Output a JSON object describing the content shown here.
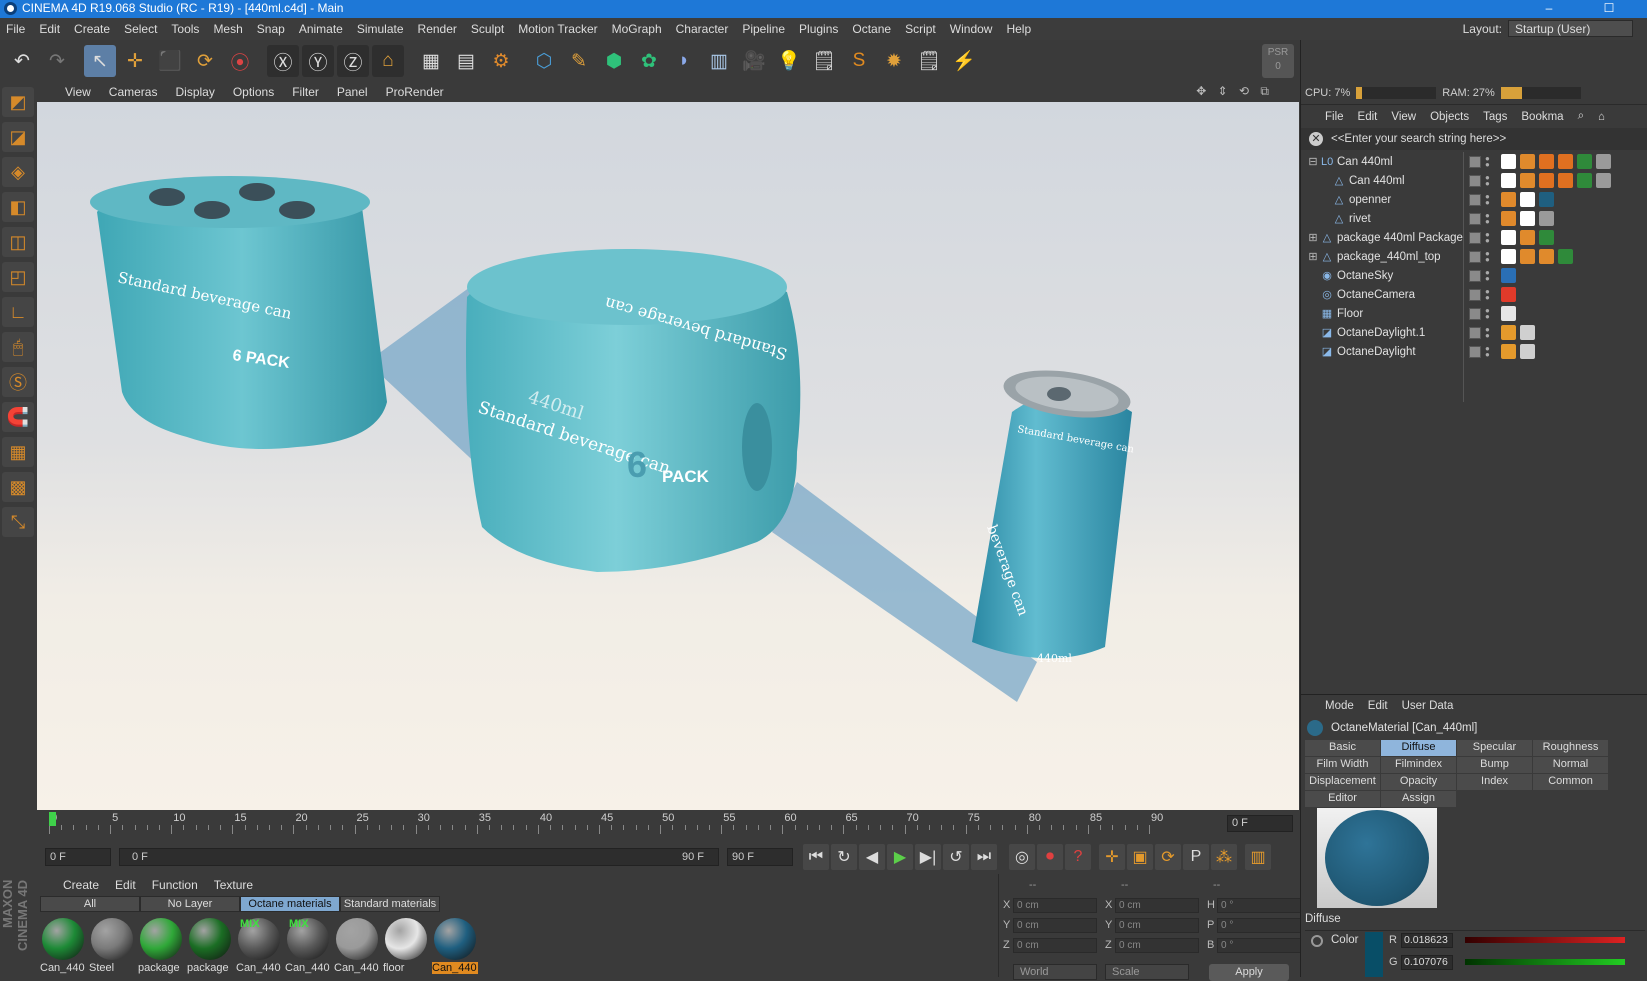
{
  "window": {
    "title": "CINEMA 4D R19.068 Studio (RC - R19) - [440ml.c4d] - Main",
    "min": "–",
    "max": "☐"
  },
  "menubar": [
    "File",
    "Edit",
    "Create",
    "Select",
    "Tools",
    "Mesh",
    "Snap",
    "Animate",
    "Simulate",
    "Render",
    "Sculpt",
    "Motion Tracker",
    "MoGraph",
    "Character",
    "Pipeline",
    "Plugins",
    "Octane",
    "Script",
    "Window",
    "Help"
  ],
  "layout": {
    "label": "Layout:",
    "value": "Startup (User)"
  },
  "toolbar_icons": [
    "undo-icon",
    "redo-icon",
    "live-select-icon",
    "move-icon",
    "scale-icon",
    "rotate-icon",
    "recent-tool-icon",
    "x-axis-icon",
    "y-axis-icon",
    "z-axis-icon",
    "coordinate-system-icon",
    "render-view-icon",
    "render-picture-viewer-icon",
    "render-settings-icon",
    "cube-icon",
    "pen-icon",
    "subdivision-icon",
    "cloner-icon",
    "deformer-icon",
    "floor-icon",
    "camera-icon",
    "light-icon",
    "octane-icon",
    "script-icon",
    "settings-icon",
    "live-viewer-icon",
    "paint-icon"
  ],
  "toolbar_glyphs": [
    "↶",
    "↷",
    "↖",
    "✛",
    "⬛",
    "⟳",
    "⦿",
    "Ⓧ",
    "Ⓨ",
    "Ⓩ",
    "⌂",
    "▦",
    "▤",
    "⚙",
    "⬡",
    "✎",
    "⬢",
    "✿",
    "◗",
    "▥",
    "🎥",
    "💡",
    "🗒",
    "S",
    "✹",
    "🗒",
    "⚡"
  ],
  "psr": {
    "label": "PSR",
    "value": "0"
  },
  "left_tools": [
    "◩",
    "◪",
    "◈",
    "◧",
    "◫",
    "◰",
    "∟",
    "🖱",
    "Ⓢ",
    "🧲",
    "▦",
    "▩",
    "⤡"
  ],
  "brand_vertical": "MAXON CINEMA 4D",
  "viewport_menu": [
    "View",
    "Cameras",
    "Display",
    "Options",
    "Filter",
    "Panel",
    "ProRender"
  ],
  "viewport_nav": "✥ ⇕ ⟲ ⧉",
  "scene_text": {
    "pack1_brand": "Standard beverage can",
    "pack1_pack": "6 PACK",
    "pack2_top": "Standard beverage can",
    "pack2_side": "Standard beverage can",
    "pack2_pack": "PACK",
    "pack2_six": "6",
    "pack2_ml": "440ml",
    "can_brand": "Standard beverage can",
    "can_ml": "440ml",
    "can_side": "beverage can"
  },
  "timeline": {
    "labels": [
      "0",
      "5",
      "10",
      "15",
      "20",
      "25",
      "30",
      "35",
      "40",
      "45",
      "50",
      "55",
      "60",
      "65",
      "70",
      "75",
      "80",
      "85",
      "90"
    ],
    "max": 90,
    "current_frame": "0 F"
  },
  "playback": {
    "start": "0 F",
    "range_start": "0 F",
    "range_end": "90 F",
    "end": "90 F",
    "buttons": [
      "⏮",
      "↻",
      "◀",
      "▶",
      "▶|",
      "↺",
      "⏭"
    ],
    "right_buttons": [
      "◎",
      "⏺",
      "?",
      "✛",
      "▣",
      "⟳",
      "P",
      "⁂",
      "▥"
    ]
  },
  "material_manager": {
    "menu": [
      "Create",
      "Edit",
      "Function",
      "Texture"
    ],
    "tabs": [
      "All",
      "No Layer",
      "Octane materials",
      "Standard materials"
    ],
    "active_tab": 2,
    "materials": [
      {
        "name": "Can_440",
        "color": "#1d8a36",
        "mix": ""
      },
      {
        "name": "Steel",
        "color": "#7a7a7a",
        "mix": ""
      },
      {
        "name": "package",
        "color": "#2fa838",
        "mix": ""
      },
      {
        "name": "package",
        "color": "#1b6e24",
        "mix": ""
      },
      {
        "name": "Can_440",
        "color": "#5a5a5a",
        "mix": "MIX"
      },
      {
        "name": "Can_440",
        "color": "#5a5a5a",
        "mix": "MIX"
      },
      {
        "name": "Can_440",
        "color": "#9a9a9a",
        "mix": ""
      },
      {
        "name": "floor",
        "color": "#e6e6e6",
        "mix": ""
      },
      {
        "name": "Can_440",
        "color": "#1f5f80",
        "mix": ""
      }
    ],
    "active_material": 8
  },
  "coordinates": {
    "header": [
      "--",
      "--",
      "--"
    ],
    "rows": [
      {
        "a": "X",
        "av": "0 cm",
        "b": "X",
        "bv": "0 cm",
        "c": "H",
        "cv": "0 °"
      },
      {
        "a": "Y",
        "av": "0 cm",
        "b": "Y",
        "bv": "0 cm",
        "c": "P",
        "cv": "0 °"
      },
      {
        "a": "Z",
        "av": "0 cm",
        "b": "Z",
        "bv": "0 cm",
        "c": "B",
        "cv": "0 °"
      }
    ],
    "space": "World",
    "mode": "Scale",
    "apply": "Apply"
  },
  "stats": {
    "cpu_label": "CPU: 7%",
    "cpu": 0.07,
    "ram_label": "RAM: 27%",
    "ram": 0.27
  },
  "object_manager": {
    "menu": [
      "File",
      "Edit",
      "View",
      "Objects",
      "Tags",
      "Bookma"
    ],
    "search_placeholder": "<<Enter your search string here>>",
    "objects": [
      {
        "name": "Can 440ml",
        "depth": 0,
        "expander": "⊟",
        "icon": "L0",
        "tags": [
          "#ffffff",
          "#e08a2c",
          "#e07020",
          "#e07020",
          "#2f8a3a",
          "#9a9a9a"
        ]
      },
      {
        "name": "Can 440ml",
        "depth": 1,
        "expander": "",
        "icon": "△",
        "tags": [
          "#ffffff",
          "#e08a2c",
          "#e07020",
          "#e07020",
          "#2f8a3a",
          "#9a9a9a"
        ]
      },
      {
        "name": "openner",
        "depth": 1,
        "expander": "",
        "icon": "△",
        "tags": [
          "#e08a2c",
          "#ffffff",
          "#1f5f80"
        ]
      },
      {
        "name": "rivet",
        "depth": 1,
        "expander": "",
        "icon": "△",
        "tags": [
          "#e08a2c",
          "#ffffff",
          "#9a9a9a"
        ]
      },
      {
        "name": "package 440ml Package",
        "depth": 0,
        "expander": "⊞",
        "icon": "△",
        "tags": [
          "#ffffff",
          "#e08a2c",
          "#2f8a3a"
        ]
      },
      {
        "name": "package_440ml_top",
        "depth": 0,
        "expander": "⊞",
        "icon": "△",
        "tags": [
          "#ffffff",
          "#e08a2c",
          "#e08a2c",
          "#2f8a3a"
        ]
      },
      {
        "name": "OctaneSky",
        "depth": 0,
        "expander": "",
        "icon": "◉",
        "tags": [
          "#2a6fb5"
        ]
      },
      {
        "name": "OctaneCamera",
        "depth": 0,
        "expander": "",
        "icon": "◎",
        "tags": [
          "#e03a2a"
        ]
      },
      {
        "name": "Floor",
        "depth": 0,
        "expander": "",
        "icon": "▦",
        "tags": [
          "#e6e6e6"
        ]
      },
      {
        "name": "OctaneDaylight.1",
        "depth": 0,
        "expander": "",
        "icon": "◪",
        "tags": [
          "#e49a2c",
          "#d0d0d0"
        ]
      },
      {
        "name": "OctaneDaylight",
        "depth": 0,
        "expander": "",
        "icon": "◪",
        "tags": [
          "#e49a2c",
          "#d0d0d0"
        ]
      }
    ]
  },
  "attribute_manager": {
    "menu": [
      "Mode",
      "Edit",
      "User Data"
    ],
    "material": "OctaneMaterial [Can_440ml]",
    "tabs": [
      "Basic",
      "Diffuse",
      "Specular",
      "Roughness",
      "Film Width",
      "Filmindex",
      "Bump",
      "Normal",
      "Displacement",
      "Opacity",
      "Index",
      "Common",
      "Editor",
      "Assign"
    ],
    "active_tab": 1,
    "section": "Diffuse",
    "color_label": "Color",
    "r_label": "R",
    "r": "0.018623",
    "g_label": "G",
    "g": "0.107076",
    "swatch": "#084e67"
  }
}
